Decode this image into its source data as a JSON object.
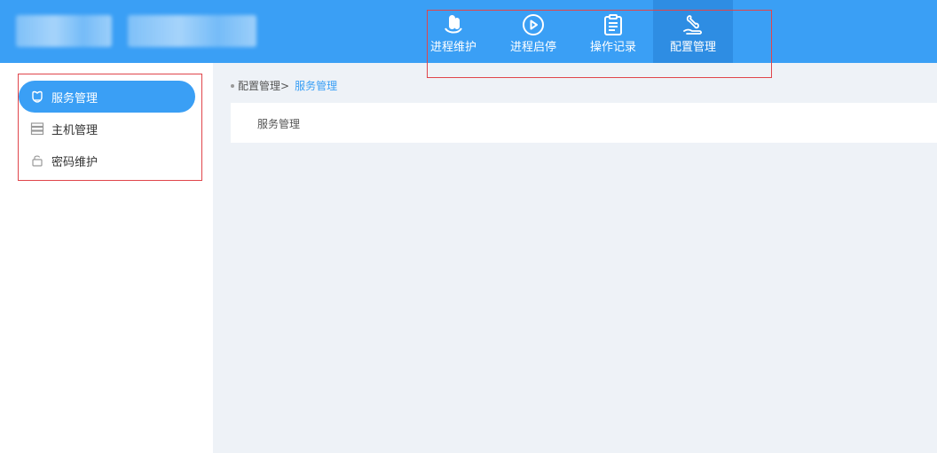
{
  "header": {
    "nav": [
      {
        "label": "进程维护",
        "icon": "process-maintenance-icon",
        "active": false
      },
      {
        "label": "进程启停",
        "icon": "play-circle-icon",
        "active": false
      },
      {
        "label": "操作记录",
        "icon": "clipboard-list-icon",
        "active": false
      },
      {
        "label": "配置管理",
        "icon": "wrench-hand-icon",
        "active": true
      }
    ]
  },
  "sidebar": {
    "items": [
      {
        "label": "服务管理",
        "icon": "service-icon",
        "active": true
      },
      {
        "label": "主机管理",
        "icon": "server-icon",
        "active": false
      },
      {
        "label": "密码维护",
        "icon": "lock-icon",
        "active": false
      }
    ]
  },
  "breadcrumb": {
    "parent": "配置管理>",
    "current": "服务管理"
  },
  "panel": {
    "title": "服务管理"
  },
  "colors": {
    "primary": "#3a9ff5",
    "active_nav": "#2e8de3",
    "annotation": "#e0454b",
    "content_bg": "#eef2f7"
  }
}
